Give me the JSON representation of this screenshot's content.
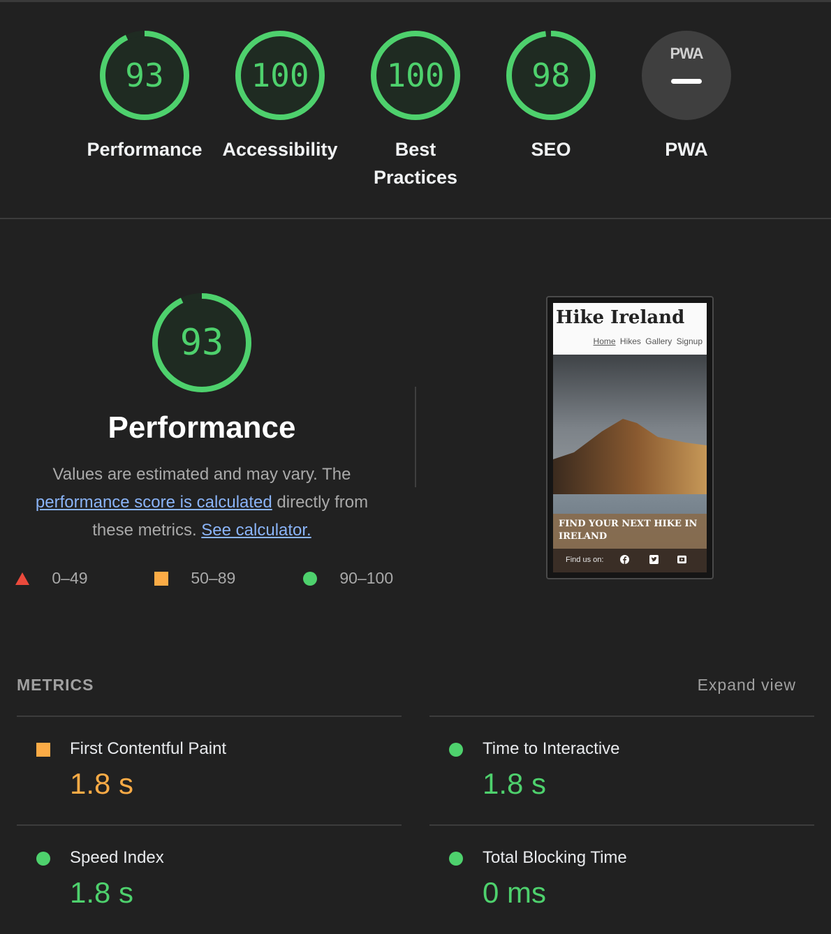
{
  "categories": [
    {
      "id": "performance",
      "score": "93",
      "label": "Performance",
      "status": "pass",
      "fraction": 0.93
    },
    {
      "id": "accessibility",
      "score": "100",
      "label": "Accessibility",
      "status": "pass",
      "fraction": 1.0
    },
    {
      "id": "best-practices",
      "score": "100",
      "label": "Best\nPractices",
      "status": "pass",
      "fraction": 1.0
    },
    {
      "id": "seo",
      "score": "98",
      "label": "SEO",
      "status": "pass",
      "fraction": 0.98
    },
    {
      "id": "pwa",
      "score": "",
      "label": "PWA",
      "status": "na",
      "badge": "PWA"
    }
  ],
  "performance": {
    "score": "93",
    "title": "Performance",
    "desc_1": "Values are estimated and may vary. The",
    "link_1": "performance score is calculated",
    "desc_2": " directly from these metrics. ",
    "link_2": "See calculator."
  },
  "legend": [
    {
      "shape": "triangle",
      "range": "0–49",
      "color": "#eb4a3c"
    },
    {
      "shape": "square",
      "range": "50–89",
      "color": "#fbab46"
    },
    {
      "shape": "circle",
      "range": "90–100",
      "color": "#4ed16d"
    }
  ],
  "screenshot": {
    "site_title": "Hike Ireland",
    "nav": [
      "Home",
      "Hikes",
      "Gallery",
      "Signup"
    ],
    "cta_line1": "FIND YOUR NEXT HIKE IN",
    "cta_line2": "IRELAND",
    "footer_text": "Find us on:",
    "social_icons": [
      "facebook-icon",
      "twitter-icon",
      "youtube-icon"
    ]
  },
  "metrics": {
    "heading": "METRICS",
    "expand_label": "Expand view",
    "items": [
      {
        "name": "First Contentful Paint",
        "value": "1.8 s",
        "status": "average",
        "color": "#fbab46"
      },
      {
        "name": "Time to Interactive",
        "value": "1.8 s",
        "status": "pass",
        "color": "#4ed16d"
      },
      {
        "name": "Speed Index",
        "value": "1.8 s",
        "status": "pass",
        "color": "#4ed16d"
      },
      {
        "name": "Total Blocking Time",
        "value": "0 ms",
        "status": "pass",
        "color": "#4ed16d"
      }
    ]
  },
  "colors": {
    "pass": "#4ed16d",
    "average": "#fbab46",
    "fail": "#eb4a3c",
    "background": "#212121"
  }
}
